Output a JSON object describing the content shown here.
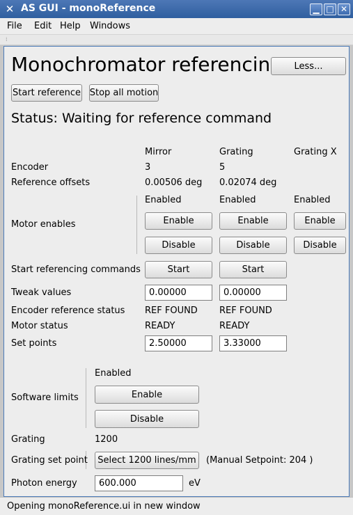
{
  "window": {
    "title": "AS GUI - monoReference",
    "app_icon": "x-icon"
  },
  "menu": [
    "File",
    "Edit",
    "Help",
    "Windows"
  ],
  "heading": "Monochromator referencing",
  "less_button": "Less...",
  "start_reference_button": "Start reference",
  "stop_all_button": "Stop all motion",
  "status": "Status: Waiting for reference command",
  "columns": [
    "Mirror",
    "Grating",
    "Grating X"
  ],
  "rows": {
    "encoder": {
      "label": "Encoder",
      "mirror": "3",
      "grating": "5"
    },
    "reference_offsets": {
      "label": "Reference offsets",
      "mirror": "0.00506 deg",
      "grating": "0.02074 deg"
    },
    "motor_enables": {
      "label": "Motor enables",
      "state": [
        "Enabled",
        "Enabled",
        "Enabled"
      ],
      "enable": [
        "Enable",
        "Enable",
        "Enable"
      ],
      "disable": [
        "Disable",
        "Disable",
        "Disable"
      ]
    },
    "start_commands": {
      "label": "Start referencing commands",
      "mirror": "Start",
      "grating": "Start"
    },
    "tweak": {
      "label": "Tweak values",
      "mirror": "0.00000",
      "grating": "0.00000"
    },
    "enc_ref_status": {
      "label": "Encoder reference status",
      "mirror": "REF FOUND",
      "grating": "REF FOUND"
    },
    "motor_status": {
      "label": "Motor status",
      "mirror": "READY",
      "grating": "READY"
    },
    "set_points": {
      "label": "Set points",
      "mirror": "2.50000",
      "grating": "3.33000"
    }
  },
  "software_limits": {
    "label": "Software limits",
    "state": "Enabled",
    "enable": "Enable",
    "disable": "Disable"
  },
  "grating": {
    "label": "Grating",
    "value": "1200"
  },
  "grating_set_point": {
    "label": "Grating set point",
    "button": "Select 1200 lines/mm",
    "manual": "(Manual Setpoint: 204 )"
  },
  "photon_energy": {
    "label": "Photon energy",
    "value": "600.000",
    "unit": "eV"
  },
  "status_bar": "Opening monoReference.ui in new window",
  "colors": {
    "titlebar": "#3a68aa",
    "panel_border": "#4a7ab8",
    "background": "#ededed"
  }
}
